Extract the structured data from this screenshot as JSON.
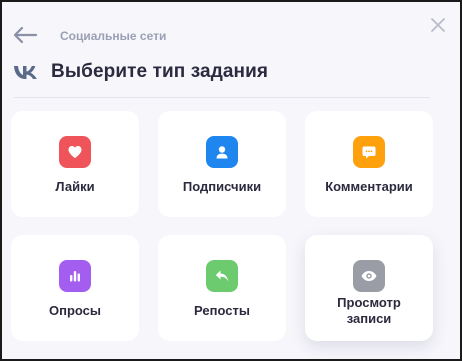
{
  "header": {
    "breadcrumb": "Социальные сети",
    "title": "Выберите тип задания"
  },
  "colors": {
    "likes": "#f0545b",
    "subscribers": "#1f86ef",
    "comments": "#ffa00d",
    "polls": "#a35ef0",
    "reposts": "#6dcb6f",
    "views": "#9a9da6",
    "vk": "#5a6b8a"
  },
  "cards": [
    {
      "label": "Лайки",
      "icon": "heart-icon"
    },
    {
      "label": "Подписчики",
      "icon": "user-icon"
    },
    {
      "label": "Комментарии",
      "icon": "comment-icon"
    },
    {
      "label": "Опросы",
      "icon": "bar-chart-icon"
    },
    {
      "label": "Репосты",
      "icon": "reply-arrow-icon"
    },
    {
      "label": "Просмотр\nзаписи",
      "icon": "eye-icon"
    }
  ]
}
